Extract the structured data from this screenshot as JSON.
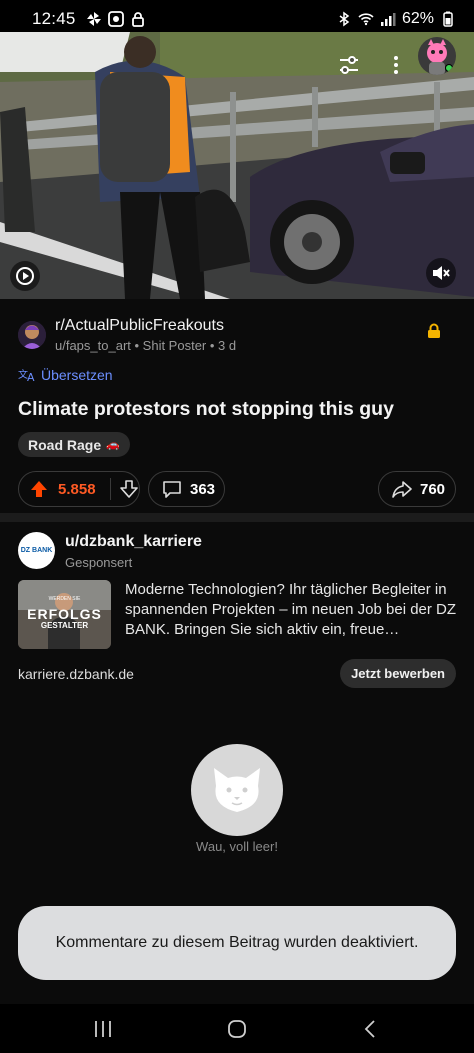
{
  "status_bar": {
    "time": "12:45",
    "battery": "62%"
  },
  "post": {
    "subreddit": "r/ActualPublicFreakouts",
    "author": "u/faps_to_art",
    "author_flair": "Shit Poster",
    "age": "3 d",
    "translate_label": "Übersetzen",
    "title": "Climate protestors not stopping this guy",
    "flair": "Road Rage",
    "flair_emoji": "🚗",
    "upvotes": "5.858",
    "comments": "363",
    "shares": "760"
  },
  "ad": {
    "advertiser": "u/dzbank_karriere",
    "sponsored_label": "Gesponsert",
    "avatar_text": "DZ BANK",
    "thumb_small_text": "WERDEN SIE",
    "thumb_big_text_1": "ERFOLGS",
    "thumb_big_text_2": "GESTALTER",
    "body": "Moderne Technologien? Ihr täglicher Begleiter in spannenden Projekten – im neuen Job bei der DZ BANK. Bringen Sie sich aktiv ein, freue…",
    "domain": "karriere.dzbank.de",
    "cta": "Jetzt bewerben"
  },
  "empty_state": {
    "text": "Wau, voll leer!"
  },
  "toast": {
    "text": "Kommentare zu diesem Beitrag wurden deaktiviert."
  },
  "colors": {
    "upvote": "#ff4500",
    "link_blue": "#6c8fff",
    "lock_gold": "#f5b400"
  }
}
